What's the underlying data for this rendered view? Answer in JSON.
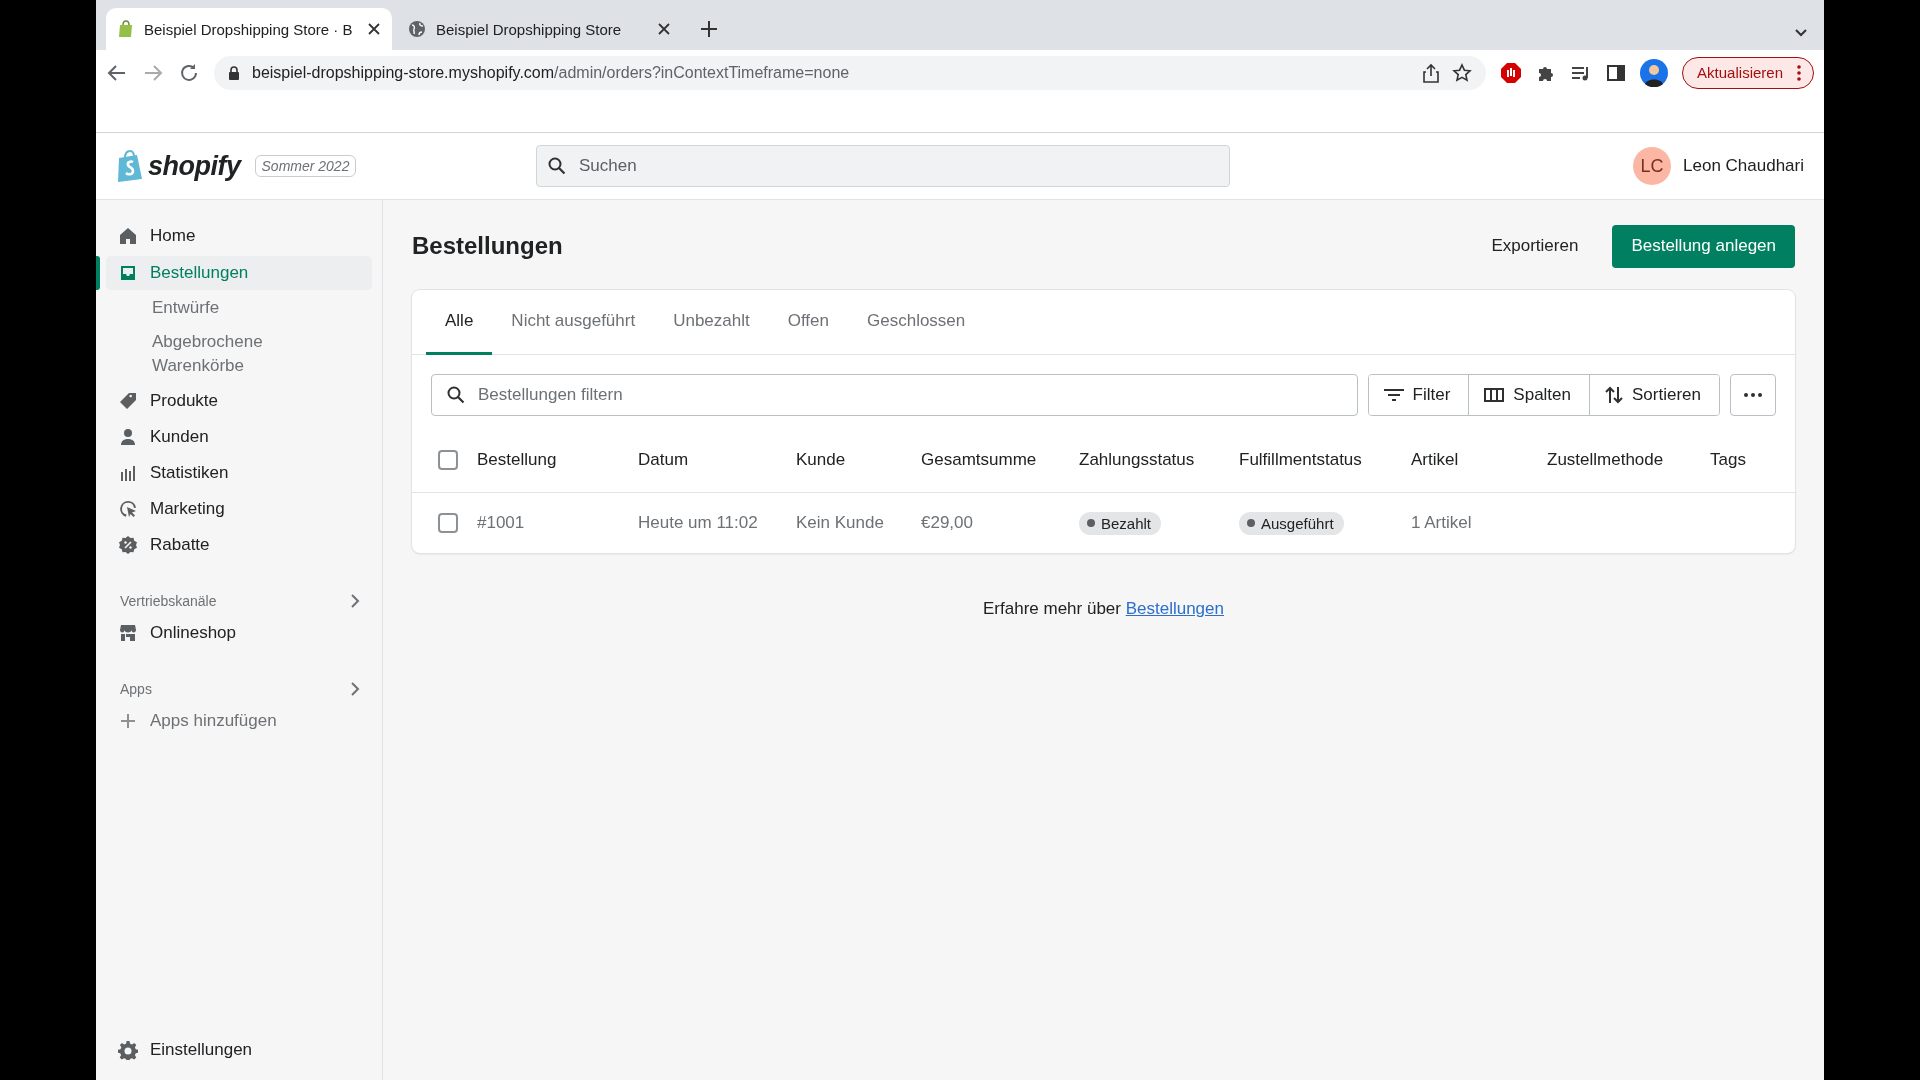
{
  "browser": {
    "tabs": [
      {
        "title": "Beispiel Dropshipping Store · B",
        "selected": true,
        "kind": "shop"
      },
      {
        "title": "Beispiel Dropshipping Store",
        "selected": false,
        "kind": "globe"
      }
    ],
    "url": {
      "host": "beispiel-dropshipping-store.myshopify.com",
      "path": "/admin/orders?inContextTimeframe=none"
    },
    "update_button": "Aktualisieren"
  },
  "header": {
    "logo_text": "shopify",
    "edition": "Sommer 2022",
    "search": {
      "placeholder": "Suchen"
    },
    "user": {
      "initials": "LC",
      "name": "Leon Chaudhari"
    }
  },
  "sidebar": {
    "items": [
      {
        "label": "Home",
        "selected": false
      },
      {
        "label": "Bestellungen",
        "selected": true,
        "children": [
          {
            "label": "Entwürfe"
          },
          {
            "label": "Abgebrochene Warenkörbe"
          }
        ]
      },
      {
        "label": "Produkte",
        "selected": false
      },
      {
        "label": "Kunden",
        "selected": false
      },
      {
        "label": "Statistiken",
        "selected": false
      },
      {
        "label": "Marketing",
        "selected": false
      },
      {
        "label": "Rabatte",
        "selected": false
      }
    ],
    "sections": [
      {
        "title": "Vertriebskanäle",
        "items": [
          {
            "label": "Onlineshop",
            "kind": "link"
          }
        ]
      },
      {
        "title": "Apps",
        "items": [
          {
            "label": "Apps hinzufügen",
            "kind": "add"
          }
        ]
      }
    ],
    "settings": "Einstellungen"
  },
  "page": {
    "title": "Bestellungen",
    "secondary_button": "Exportieren",
    "primary_button": "Bestellung anlegen",
    "tabs": [
      {
        "label": "Alle",
        "selected": true
      },
      {
        "label": "Nicht ausgeführt",
        "selected": false
      },
      {
        "label": "Unbezahlt",
        "selected": false
      },
      {
        "label": "Offen",
        "selected": false
      },
      {
        "label": "Geschlossen",
        "selected": false
      }
    ],
    "filter": {
      "placeholder": "Bestellungen filtern"
    },
    "toolbar_buttons": [
      {
        "label": "Filter",
        "kind": "filter"
      },
      {
        "label": "Spalten",
        "kind": "columns"
      },
      {
        "label": "Sortieren",
        "kind": "sort"
      }
    ],
    "table": {
      "select_all": {
        "checked": false
      },
      "columns": [
        "Bestellung",
        "Datum",
        "Kunde",
        "Gesamtsumme",
        "Zahlungsstatus",
        "Fulfillmentstatus",
        "Artikel",
        "Zustellmethode",
        "Tags"
      ],
      "rows": [
        {
          "checked": false,
          "order": "#1001",
          "date": "Heute um 11:02",
          "customer": "Kein Kunde",
          "total": "€29,00",
          "payment_status": "Bezahlt",
          "fulfillment_status": "Ausgeführt",
          "items": "1 Artikel"
        }
      ]
    },
    "footer": {
      "text": "Erfahre mehr über ",
      "link": "Bestellungen"
    }
  }
}
